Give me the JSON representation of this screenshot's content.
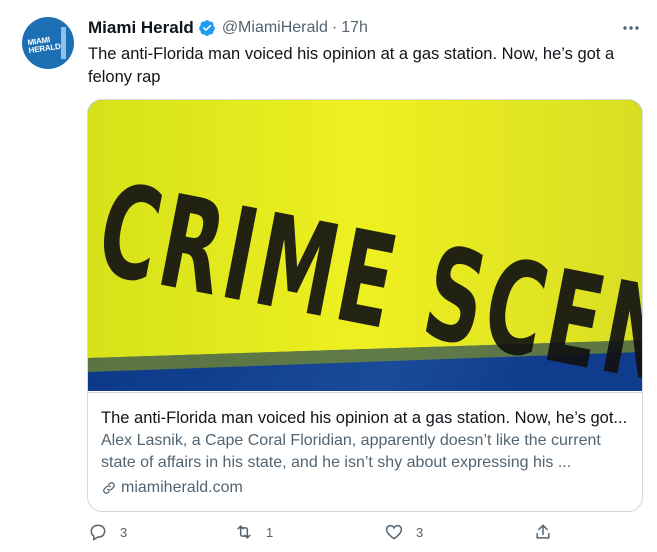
{
  "account": {
    "name": "Miami Herald",
    "handle": "@MiamiHerald",
    "separator": "·",
    "time": "17h",
    "avatar_text": "MIAMI HERALD"
  },
  "tweet": {
    "text": "The anti-Florida man voiced his opinion at a gas station. Now, he’s got a felony rap"
  },
  "card": {
    "image_tape_text": "CRIME SCENE DO NOT CROSS",
    "title": "The anti-Florida man voiced his opinion at a gas station. Now, he’s got...",
    "description": "Alex Lasnik, a Cape Coral Floridian, apparently doesn’t like the current state of affairs in his state, and he isn’t shy about expressing his ...",
    "domain": "miamiherald.com"
  },
  "actions": {
    "reply_count": "3",
    "retweet_count": "1",
    "like_count": "3"
  },
  "icons": {
    "verified": "verified-badge-icon",
    "more": "more-horizontal-icon",
    "link": "link-icon",
    "reply": "reply-icon",
    "retweet": "retweet-icon",
    "like": "heart-icon",
    "share": "share-icon"
  },
  "colors": {
    "verified_blue": "#1d9bf0",
    "secondary_text": "#536471",
    "primary_text": "#0f1419",
    "tape_yellow": "#e2ea1a",
    "avatar_blue": "#1d6fb4"
  }
}
